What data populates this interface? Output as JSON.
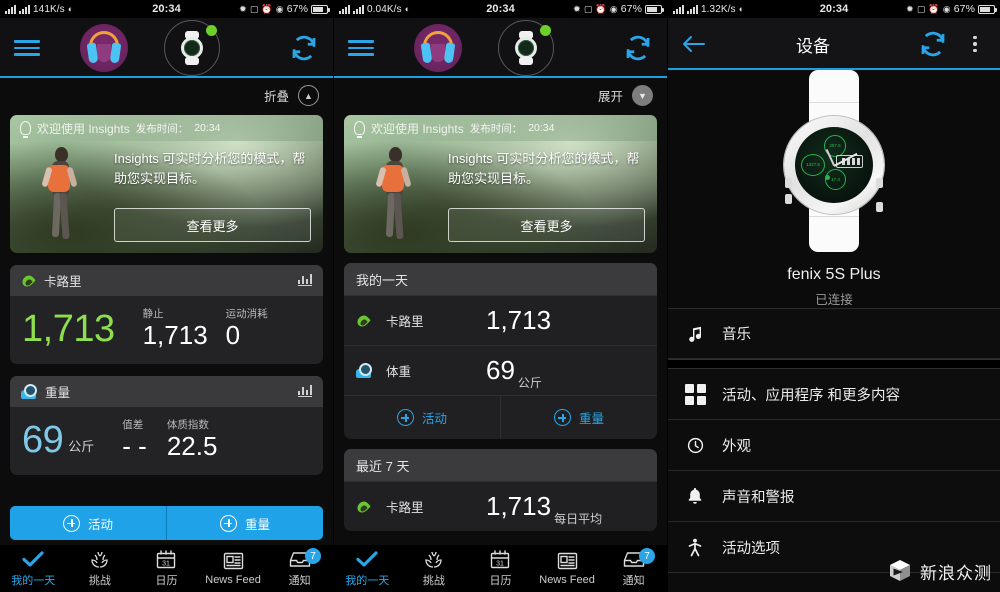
{
  "status_bar": {
    "network_speed_p1": "141K/s",
    "network_speed_p2": "0.04K/s",
    "network_speed_p3": "1.32K/s",
    "time": "20:34",
    "battery": "67%",
    "icons": [
      "signal-icon",
      "signal-icon",
      "wifi-icon",
      "bluetooth-icon",
      "vibrate-icon",
      "alarm-icon",
      "location-icon",
      "battery-icon"
    ]
  },
  "panel1": {
    "topbar": {
      "menu": "menu-icon",
      "avatar": "headphones-avatar",
      "device": "watch-device-icon",
      "sync": "sync-icon"
    },
    "collapse_label": "折叠",
    "insights": {
      "header_title": "欢迎使用 Insights",
      "header_time_label": "发布时间：",
      "header_time": "20:34",
      "body": "Insights 可实时分析您的模式，帮助您实现目标。",
      "button": "查看更多"
    },
    "calories_card": {
      "title": "卡路里",
      "main_value": "1,713",
      "sub1_label": "静止",
      "sub1_value": "1,713",
      "sub2_label": "运动消耗",
      "sub2_value": "0"
    },
    "weight_card": {
      "title": "重量",
      "main_value": "69",
      "main_unit": "公斤",
      "sub1_label": "值差",
      "sub1_value": "- -",
      "sub2_label": "体质指数",
      "sub2_value": "22.5"
    },
    "actions": [
      {
        "label": "活动"
      },
      {
        "label": "重量"
      }
    ],
    "bottom_nav": [
      {
        "label": "我的一天",
        "icon": "check-icon",
        "active": true
      },
      {
        "label": "挑战",
        "icon": "laurel-icon",
        "active": false
      },
      {
        "label": "日历",
        "icon": "calendar-icon",
        "active": false
      },
      {
        "label": "News Feed",
        "icon": "newsfeed-icon",
        "active": false
      },
      {
        "label": "通知",
        "icon": "inbox-icon",
        "active": false,
        "badge": "7"
      }
    ]
  },
  "panel2": {
    "expand_label": "展开",
    "myday": {
      "title": "我的一天",
      "rows": [
        {
          "icon": "flame-icon",
          "label": "卡路里",
          "value": "1,713",
          "unit": ""
        },
        {
          "icon": "scale-icon",
          "label": "体重",
          "value": "69",
          "unit": "公斤"
        }
      ],
      "actions": [
        {
          "label": "活动"
        },
        {
          "label": "重量"
        }
      ]
    },
    "last7": {
      "title": "最近 7 天",
      "rows": [
        {
          "icon": "flame-icon",
          "label": "卡路里",
          "value": "1,713",
          "unit": "每日平均"
        }
      ]
    }
  },
  "panel3": {
    "title": "设备",
    "back": "back-arrow-icon",
    "sync": "sync-icon",
    "more": "kebab-menu-icon",
    "device": {
      "name": "fenix 5S Plus",
      "status": "已连接",
      "watch_face_values": [
        "257.6",
        "1327.5",
        "17.4"
      ]
    },
    "menu": [
      {
        "label": "音乐",
        "icon": "music-note-icon"
      },
      {
        "label": "活动、应用程序 和更多内容",
        "icon": "grid-squares-icon"
      },
      {
        "label": "外观",
        "icon": "watch-face-icon"
      },
      {
        "label": "声音和警报",
        "icon": "bell-icon"
      },
      {
        "label": "活动选项",
        "icon": "person-activity-icon"
      }
    ],
    "watermark": "新浪众测"
  },
  "colors": {
    "accent_blue": "#2aa6e8",
    "green": "#8ede4e",
    "light_blue": "#7ec9e8",
    "card_bg": "#232326",
    "card_head": "#3a3a3d"
  }
}
